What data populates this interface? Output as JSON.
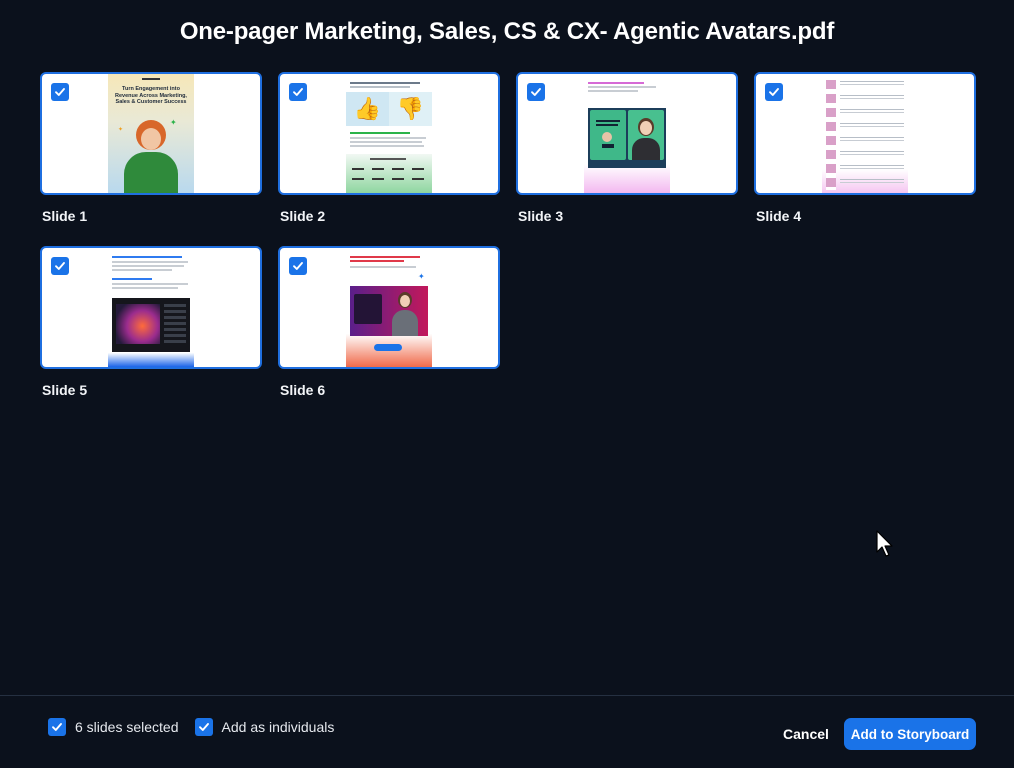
{
  "dialog": {
    "title": "One-pager Marketing, Sales, CS & CX- Agentic Avatars.pdf"
  },
  "slides": [
    {
      "label": "Slide 1",
      "checked": true,
      "thumb_text": "Turn Engagement into Revenue Across Marketing, Sales & Customer Success"
    },
    {
      "label": "Slide 2",
      "checked": true
    },
    {
      "label": "Slide 3",
      "checked": true
    },
    {
      "label": "Slide 4",
      "checked": true
    },
    {
      "label": "Slide 5",
      "checked": true
    },
    {
      "label": "Slide 6",
      "checked": true
    }
  ],
  "footer": {
    "selected_count_label": "6 slides selected",
    "individuals_label": "Add as individuals",
    "cancel_label": "Cancel",
    "add_label": "Add to Storyboard"
  },
  "colors": {
    "background": "#0b111c",
    "accent": "#1a73e8",
    "thumb_border": "#1f6fe0"
  },
  "icons": [
    "check-icon",
    "thumbs-up-icon",
    "thumbs-down-icon",
    "mouse-cursor-icon"
  ]
}
